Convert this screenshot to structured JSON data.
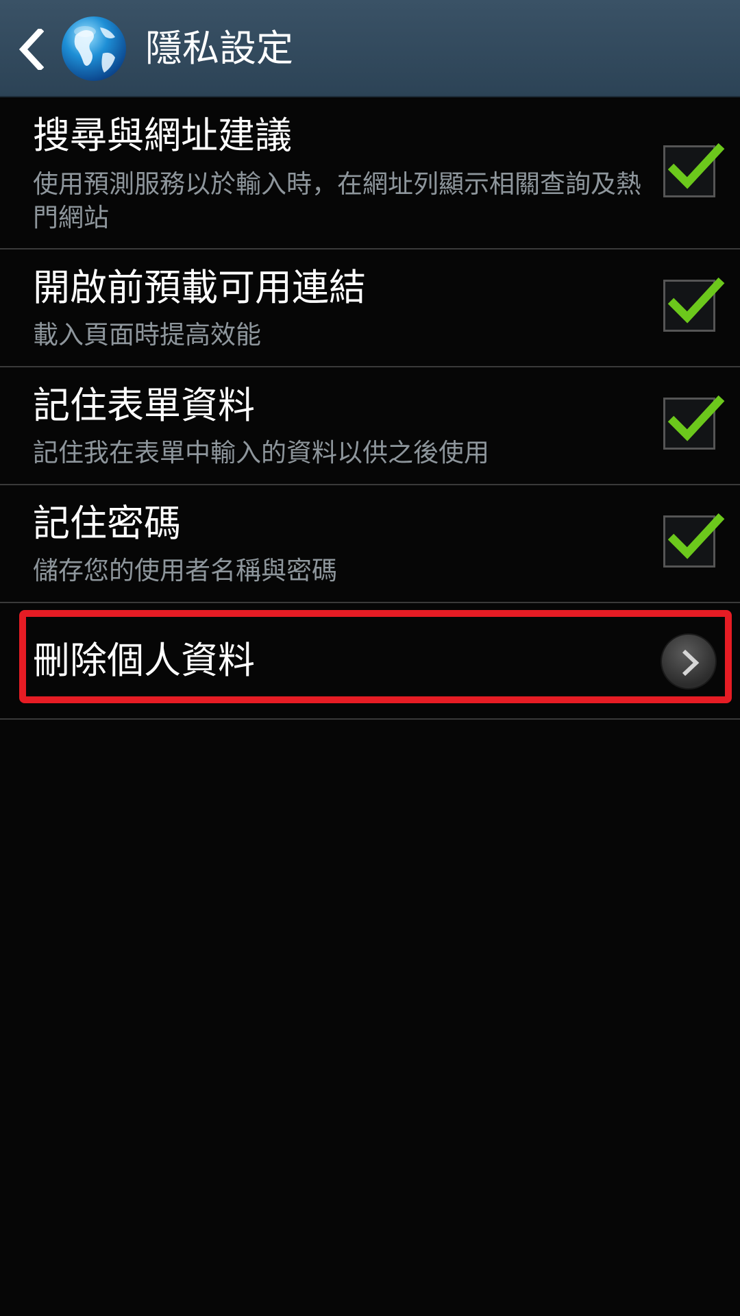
{
  "action_bar": {
    "title": "隱私設定",
    "back_icon": "back-arrow-icon",
    "app_icon": "globe-icon"
  },
  "settings": [
    {
      "title": "搜尋與網址建議",
      "subtitle": "使用預測服務以於輸入時，在網址列顯示相關查詢及熱門網站",
      "checked": true
    },
    {
      "title": "開啟前預載可用連結",
      "subtitle": "載入頁面時提高效能",
      "checked": true
    },
    {
      "title": "記住表單資料",
      "subtitle": "記住我在表單中輸入的資料以供之後使用",
      "checked": true
    },
    {
      "title": "記住密碼",
      "subtitle": "儲存您的使用者名稱與密碼",
      "checked": true
    }
  ],
  "delete_item": {
    "title": "刪除個人資料",
    "icon": "chevron-right-icon"
  },
  "colors": {
    "action_bar": "#34495c",
    "check": "#6cc81c",
    "highlight": "#e61c24",
    "subtitle": "#8e969c"
  }
}
